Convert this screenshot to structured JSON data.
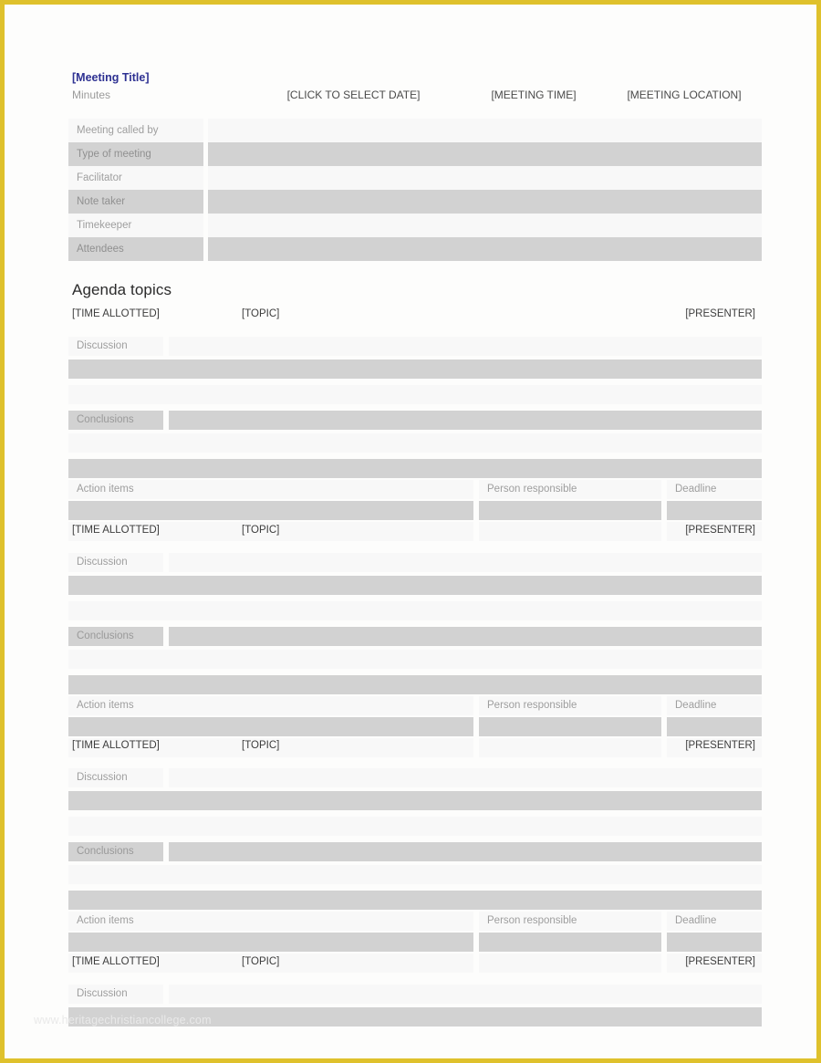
{
  "document": {
    "border_color": "#dfc12c",
    "page_background": "#fdfdfc",
    "watermark": "www.heritagechristiancollege.com"
  },
  "colors": {
    "title_blue": "#2e3192",
    "row_light": "#f8f8f8",
    "row_dark": "#d2d2d2",
    "label_gray": "#9e9e9e",
    "heading_dark": "#2b2b2b"
  },
  "header": {
    "meeting_title": "[Meeting Title]",
    "subtitle": "Minutes",
    "date": "[CLICK TO SELECT DATE]",
    "time": "[MEETING TIME]",
    "location": "[MEETING LOCATION]"
  },
  "info_table": {
    "rows": [
      {
        "label": "Meeting called by",
        "value": "",
        "shade": "light"
      },
      {
        "label": "Type of meeting",
        "value": "",
        "shade": "dark"
      },
      {
        "label": "Facilitator",
        "value": "",
        "shade": "light"
      },
      {
        "label": "Note taker",
        "value": "",
        "shade": "dark"
      },
      {
        "label": "Timekeeper",
        "value": "",
        "shade": "light"
      },
      {
        "label": "Attendees",
        "value": "",
        "shade": "dark"
      }
    ]
  },
  "agenda": {
    "heading": "Agenda topics",
    "column_headers": {
      "time_allotted": "[TIME ALLOTTED]",
      "topic": "[TOPIC]",
      "presenter": "[PRESENTER]"
    },
    "labels": {
      "discussion": "Discussion",
      "conclusions": "Conclusions",
      "action_items": "Action items",
      "person_responsible": "Person responsible",
      "deadline": "Deadline"
    },
    "blocks": [
      {
        "time_allotted": "[TIME ALLOTTED]",
        "topic": "[TOPIC]",
        "presenter": "[PRESENTER]",
        "discussion_label": "Discussion",
        "conclusions_label": "Conclusions",
        "action_items_label": "Action items",
        "person_responsible_label": "Person responsible",
        "deadline_label": "Deadline",
        "truncated": false
      },
      {
        "time_allotted": "[TIME ALLOTTED]",
        "topic": "[TOPIC]",
        "presenter": "[PRESENTER]",
        "discussion_label": "Discussion",
        "conclusions_label": "Conclusions",
        "action_items_label": "Action items",
        "person_responsible_label": "Person responsible",
        "deadline_label": "Deadline",
        "truncated": false
      },
      {
        "time_allotted": "[TIME ALLOTTED]",
        "topic": "[TOPIC]",
        "presenter": "[PRESENTER]",
        "discussion_label": "Discussion",
        "conclusions_label": "Conclusions",
        "action_items_label": "Action items",
        "person_responsible_label": "Person responsible",
        "deadline_label": "Deadline",
        "truncated": false
      },
      {
        "time_allotted": "[TIME ALLOTTED]",
        "topic": "[TOPIC]",
        "presenter": "[PRESENTER]",
        "discussion_label": "Discussion",
        "truncated": true
      }
    ]
  }
}
